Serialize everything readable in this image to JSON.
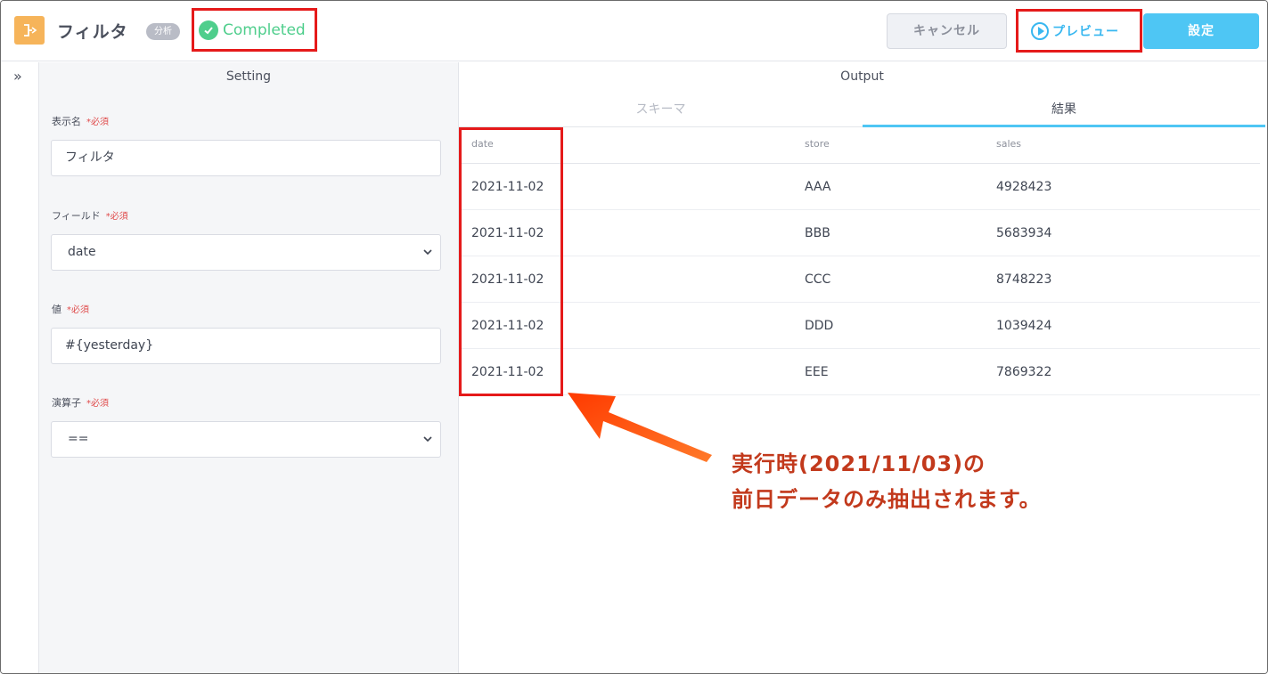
{
  "header": {
    "title": "フィルタ",
    "badge": "分析",
    "status": "Completed",
    "cancel_label": "キャンセル",
    "preview_label": "プレビュー",
    "setting_label": "設定"
  },
  "setting": {
    "panel_title": "Setting",
    "required_mark": "*必須",
    "display_name_label": "表示名",
    "display_name_value": "フィルタ",
    "field_label": "フィールド",
    "field_value": "date",
    "value_label": "値",
    "value_value": "#{yesterday}",
    "operator_label": "演算子",
    "operator_value": "=="
  },
  "output": {
    "panel_title": "Output",
    "tabs": [
      "スキーマ",
      "結果"
    ],
    "columns": [
      "date",
      "store",
      "sales"
    ],
    "rows": [
      [
        "2021-11-02",
        "AAA",
        "4928423"
      ],
      [
        "2021-11-02",
        "BBB",
        "5683934"
      ],
      [
        "2021-11-02",
        "CCC",
        "8748223"
      ],
      [
        "2021-11-02",
        "DDD",
        "1039424"
      ],
      [
        "2021-11-02",
        "EEE",
        "7869322"
      ]
    ]
  },
  "annotation": {
    "line1": "実行時(2021/11/03)の",
    "line2": "前日データのみ抽出されます。"
  },
  "colors": {
    "accent": "#4ec6f4",
    "status_green": "#4fce8c",
    "highlight_red": "#e51a1a",
    "annotation_text": "#c2391c",
    "arrow": "#ff4d0a",
    "app_icon": "#f6b45a"
  },
  "icons": {
    "app": "node-icon",
    "status": "check-circle-icon",
    "preview": "play-circle-icon",
    "rail": "double-chevron-right-icon",
    "select": "chevron-down-icon"
  }
}
